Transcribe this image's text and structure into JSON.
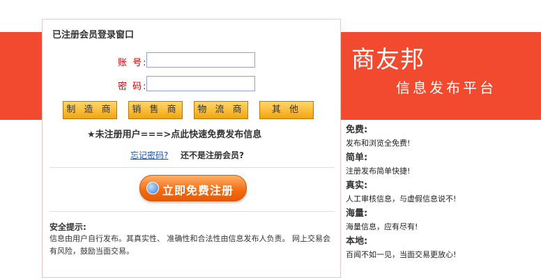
{
  "brand": {
    "title": "商友邦",
    "subtitle": "信息发布平台",
    "banner_color": "#f24a2f"
  },
  "login": {
    "title": "已注册会员登录窗口",
    "account_label": "账 号:",
    "account_value": "",
    "password_label": "密 码:",
    "password_value": ""
  },
  "categories": [
    "制 造 商",
    "销 售 商",
    "物 流 商",
    "其  他"
  ],
  "promo_text": "★未注册用户===>点此快速免费发布信息",
  "forgot_password": "忘记密码?",
  "not_member": "还不是注册会员?",
  "register_button": "立即免费注册",
  "safety": {
    "title": "安全提示:",
    "text": "信息由用户自行发布。其真实性、 准确性和合法性由信息发布人负责。 网上交易会有风险，鼓励当面交易。"
  },
  "features": [
    {
      "title": "免费:",
      "desc": "发布和浏览全免费!"
    },
    {
      "title": "简单:",
      "desc": "注册发布简单快捷!"
    },
    {
      "title": "真实:",
      "desc": "人工审核信息，与虚假信息说不!"
    },
    {
      "title": "海量:",
      "desc": "海量信息，应有尽有!"
    },
    {
      "title": "本地:",
      "desc": "百闻不如一见，当面交易更放心!"
    }
  ]
}
